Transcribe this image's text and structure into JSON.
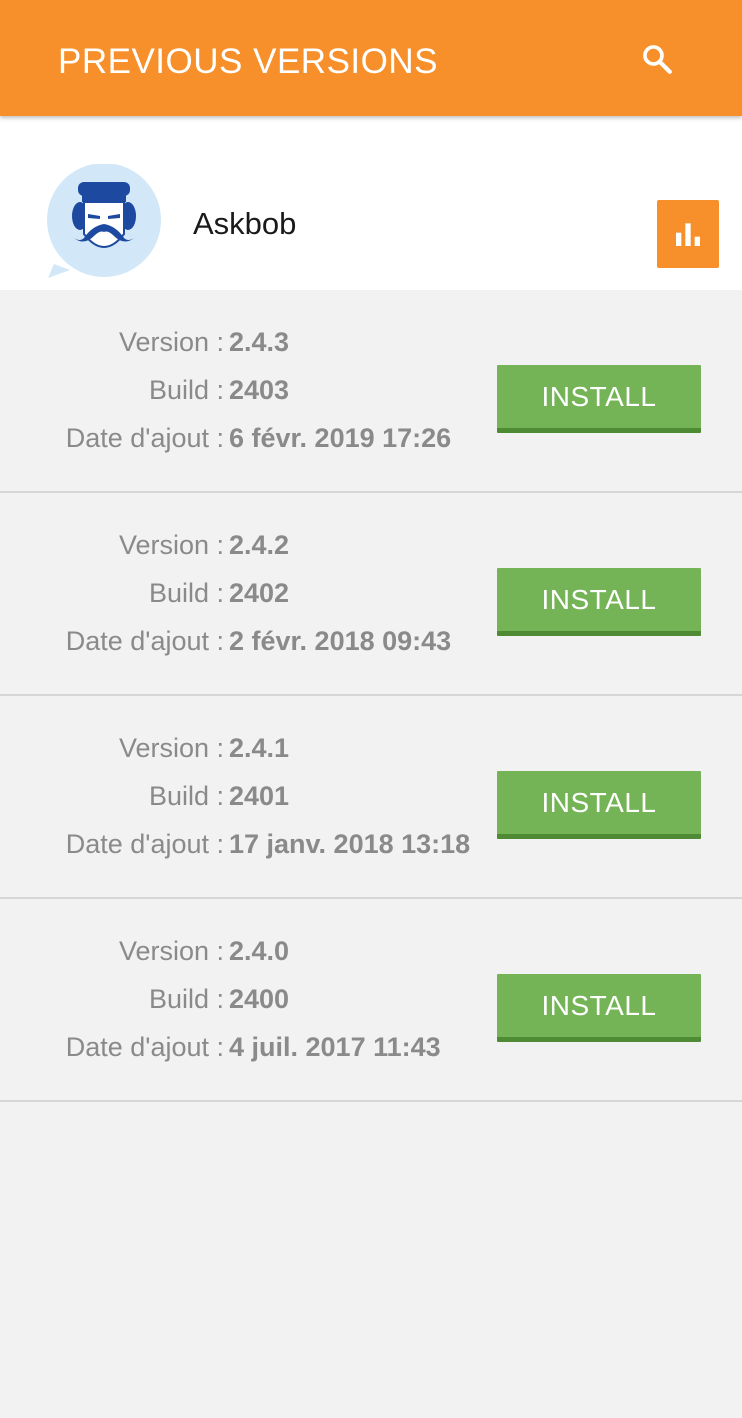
{
  "appbar": {
    "title": "PREVIOUS VERSIONS",
    "search_icon": "search-icon"
  },
  "app": {
    "name": "Askbob",
    "icon": "askbob-logo",
    "stats_icon": "bar-chart-icon"
  },
  "labels": {
    "version": "Version :",
    "build": "Build :",
    "date": "Date d'ajout :"
  },
  "versions": [
    {
      "version": "2.4.3",
      "build": "2403",
      "date": "6 févr. 2019 17:26",
      "install_label": "INSTALL"
    },
    {
      "version": "2.4.2",
      "build": "2402",
      "date": "2 févr. 2018 09:43",
      "install_label": "INSTALL"
    },
    {
      "version": "2.4.1",
      "build": "2401",
      "date": "17 janv. 2018 13:18",
      "install_label": "INSTALL"
    },
    {
      "version": "2.4.0",
      "build": "2400",
      "date": "4 juil. 2017 11:43",
      "install_label": "INSTALL"
    }
  ],
  "colors": {
    "primary": "#f78f2a",
    "install": "#74b457",
    "install_shadow": "#4f8a35",
    "text_muted": "#8a8a8a"
  }
}
